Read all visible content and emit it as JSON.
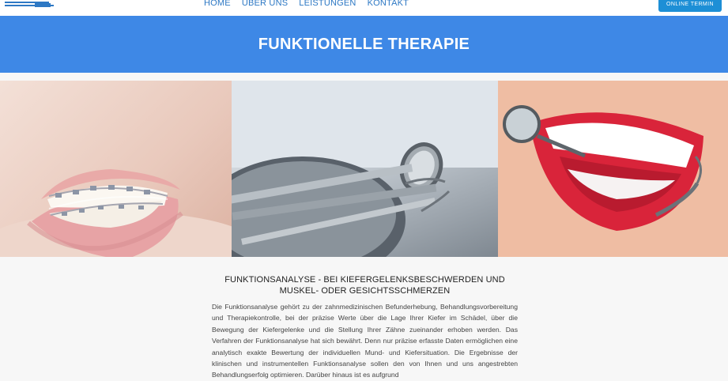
{
  "nav": {
    "logo_alt": "Praxis-Logo",
    "links": [
      "HOME",
      "ÜBER UNS",
      "LEISTUNGEN",
      "KONTAKT"
    ],
    "cta_label": "ONLINE TERMIN"
  },
  "banner": {
    "title": "FUNKTIONELLE THERAPIE"
  },
  "gallery": [
    "braces-smile-photo",
    "dental-instruments-photo",
    "white-smile-mirror-photo"
  ],
  "content": {
    "heading": "FUNKTIONSANALYSE - BEI KIEFERGELENKSBESCHWERDEN UND MUSKEL- ODER GESICHTSSCHMERZEN",
    "paragraph": "Die Funktionsanalyse gehört zu der zahnmedizinischen Befunderhebung, Behandlungsvorbereitung und Therapiekontrolle, bei der präzise Werte über die Lage Ihrer Kiefer im Schädel, über die Bewegung der Kiefergelenke und die Stellung Ihrer Zähne zueinander erhoben werden. Das Verfahren der Funktionsanalyse hat sich bewährt. Denn nur präzise erfasste Daten ermöglichen eine analytisch exakte Bewertung der individuellen Mund- und Kiefersituation. Die Ergebnisse der klinischen und instrumentellen Funktionsanalyse sollen den von Ihnen und uns angestrebten Behandlungserfolg optimieren. Darüber hinaus ist es aufgrund"
  },
  "colors": {
    "banner": "#3e88e6",
    "cta": "#1d8fd6",
    "nav_text": "#2d78c4"
  }
}
